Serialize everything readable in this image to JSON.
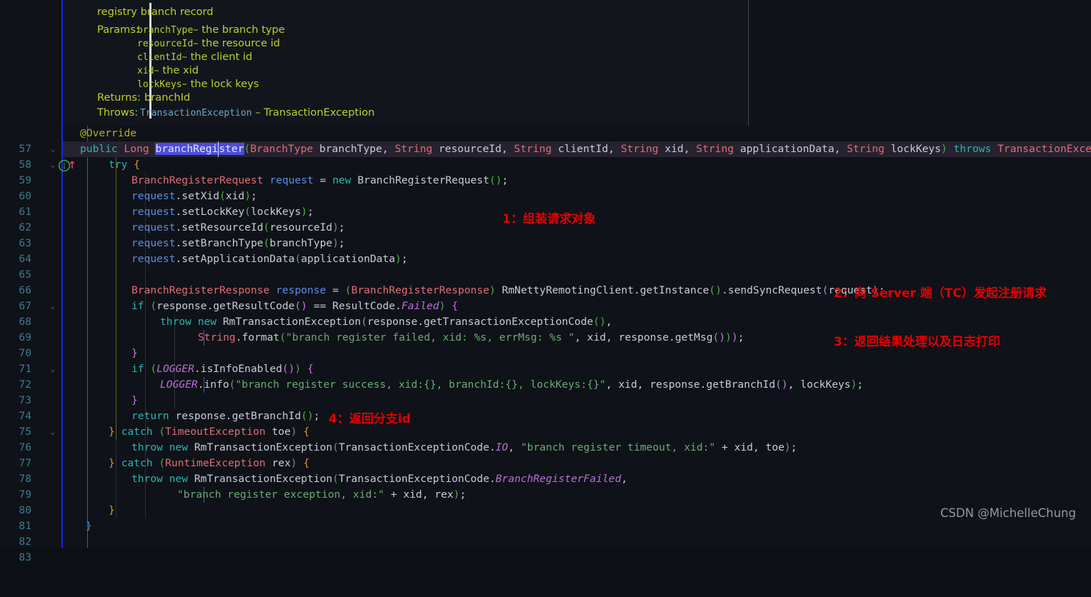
{
  "editor": {
    "theme_bg": "#0f1218",
    "gutter_accent": "#1a2ae0",
    "selection_color": "#4b4ce0",
    "highlighted_line": "58",
    "selected_text": "branchRegister"
  },
  "javadoc": {
    "summary": "registry branch record",
    "params_label": "Params:",
    "params": [
      {
        "name": "branchType",
        "sep": "–",
        "desc": "the branch type"
      },
      {
        "name": "resourceId",
        "sep": "–",
        "desc": "the resource id"
      },
      {
        "name": "clientId",
        "sep": "–",
        "desc": "the client id"
      },
      {
        "name": "xid",
        "sep": "–",
        "desc": "the xid"
      },
      {
        "name": "lockKeys",
        "sep": "–",
        "desc": "the lock keys"
      }
    ],
    "returns_label": "Returns:",
    "returns_value": "branchId",
    "throws_label": "Throws:",
    "throws_type": "TransactionException",
    "throws_sep": "–",
    "throws_desc": "TransactionException"
  },
  "gutter": {
    "icon_line_58": "implementing-method-icon",
    "line_numbers": [
      "57",
      "58",
      "59",
      "60",
      "61",
      "62",
      "63",
      "64",
      "65",
      "66",
      "67",
      "68",
      "69",
      "70",
      "71",
      "72",
      "73",
      "74",
      "75",
      "76",
      "77",
      "78",
      "79",
      "80",
      "81",
      "82",
      "83"
    ],
    "fold_lines": [
      "58",
      "59",
      "68",
      "72",
      "76"
    ]
  },
  "code": {
    "lines": {
      "57": "@Override",
      "58": "public Long branchRegister(BranchType branchType, String resourceId, String clientId, String xid, String applicationData, String lockKeys) throws TransactionException {",
      "59": "try {",
      "60": "BranchRegisterRequest request = new BranchRegisterRequest();",
      "61": "request.setXid(xid);",
      "62": "request.setLockKey(lockKeys);",
      "63": "request.setResourceId(resourceId);",
      "64": "request.setBranchType(branchType);",
      "65": "request.setApplicationData(applicationData);",
      "66": "",
      "67": "BranchRegisterResponse response = (BranchRegisterResponse) RmNettyRemotingClient.getInstance().sendSyncRequest(request);",
      "68": "if (response.getResultCode() == ResultCode.Failed) {",
      "69": "throw new RmTransactionException(response.getTransactionExceptionCode(),",
      "70": "String.format(\"branch register failed, xid: %s, errMsg: %s \", xid, response.getMsg()));",
      "71": "}",
      "72": "if (LOGGER.isInfoEnabled()) {",
      "73": "LOGGER.info(\"branch register success, xid:{}, branchId:{}, lockKeys:{}\", xid, response.getBranchId(), lockKeys);",
      "74": "}",
      "75": "return response.getBranchId();",
      "76": "} catch (TimeoutException toe) {",
      "77": "throw new RmTransactionException(TransactionExceptionCode.IO, \"branch register timeout, xid:\" + xid, toe);",
      "78": "} catch (RuntimeException rex) {",
      "79": "throw new RmTransactionException(TransactionExceptionCode.BranchRegisterFailed,",
      "80": "\"branch register exception, xid:\" + xid, rex);",
      "81": "}",
      "82": "}",
      "83": ""
    }
  },
  "annotations": [
    {
      "id": "note-1",
      "text": "1：组装请求对象",
      "color": "#e60000"
    },
    {
      "id": "note-2",
      "text": "2：向 Server 端（TC）发起注册请求",
      "color": "#e60000"
    },
    {
      "id": "note-3",
      "text": "3：返回结果处理以及日志打印",
      "color": "#e60000"
    },
    {
      "id": "note-4",
      "text": "4：返回分支id",
      "color": "#e60000"
    }
  ],
  "watermark": {
    "text": "CSDN @MichelleChung"
  }
}
